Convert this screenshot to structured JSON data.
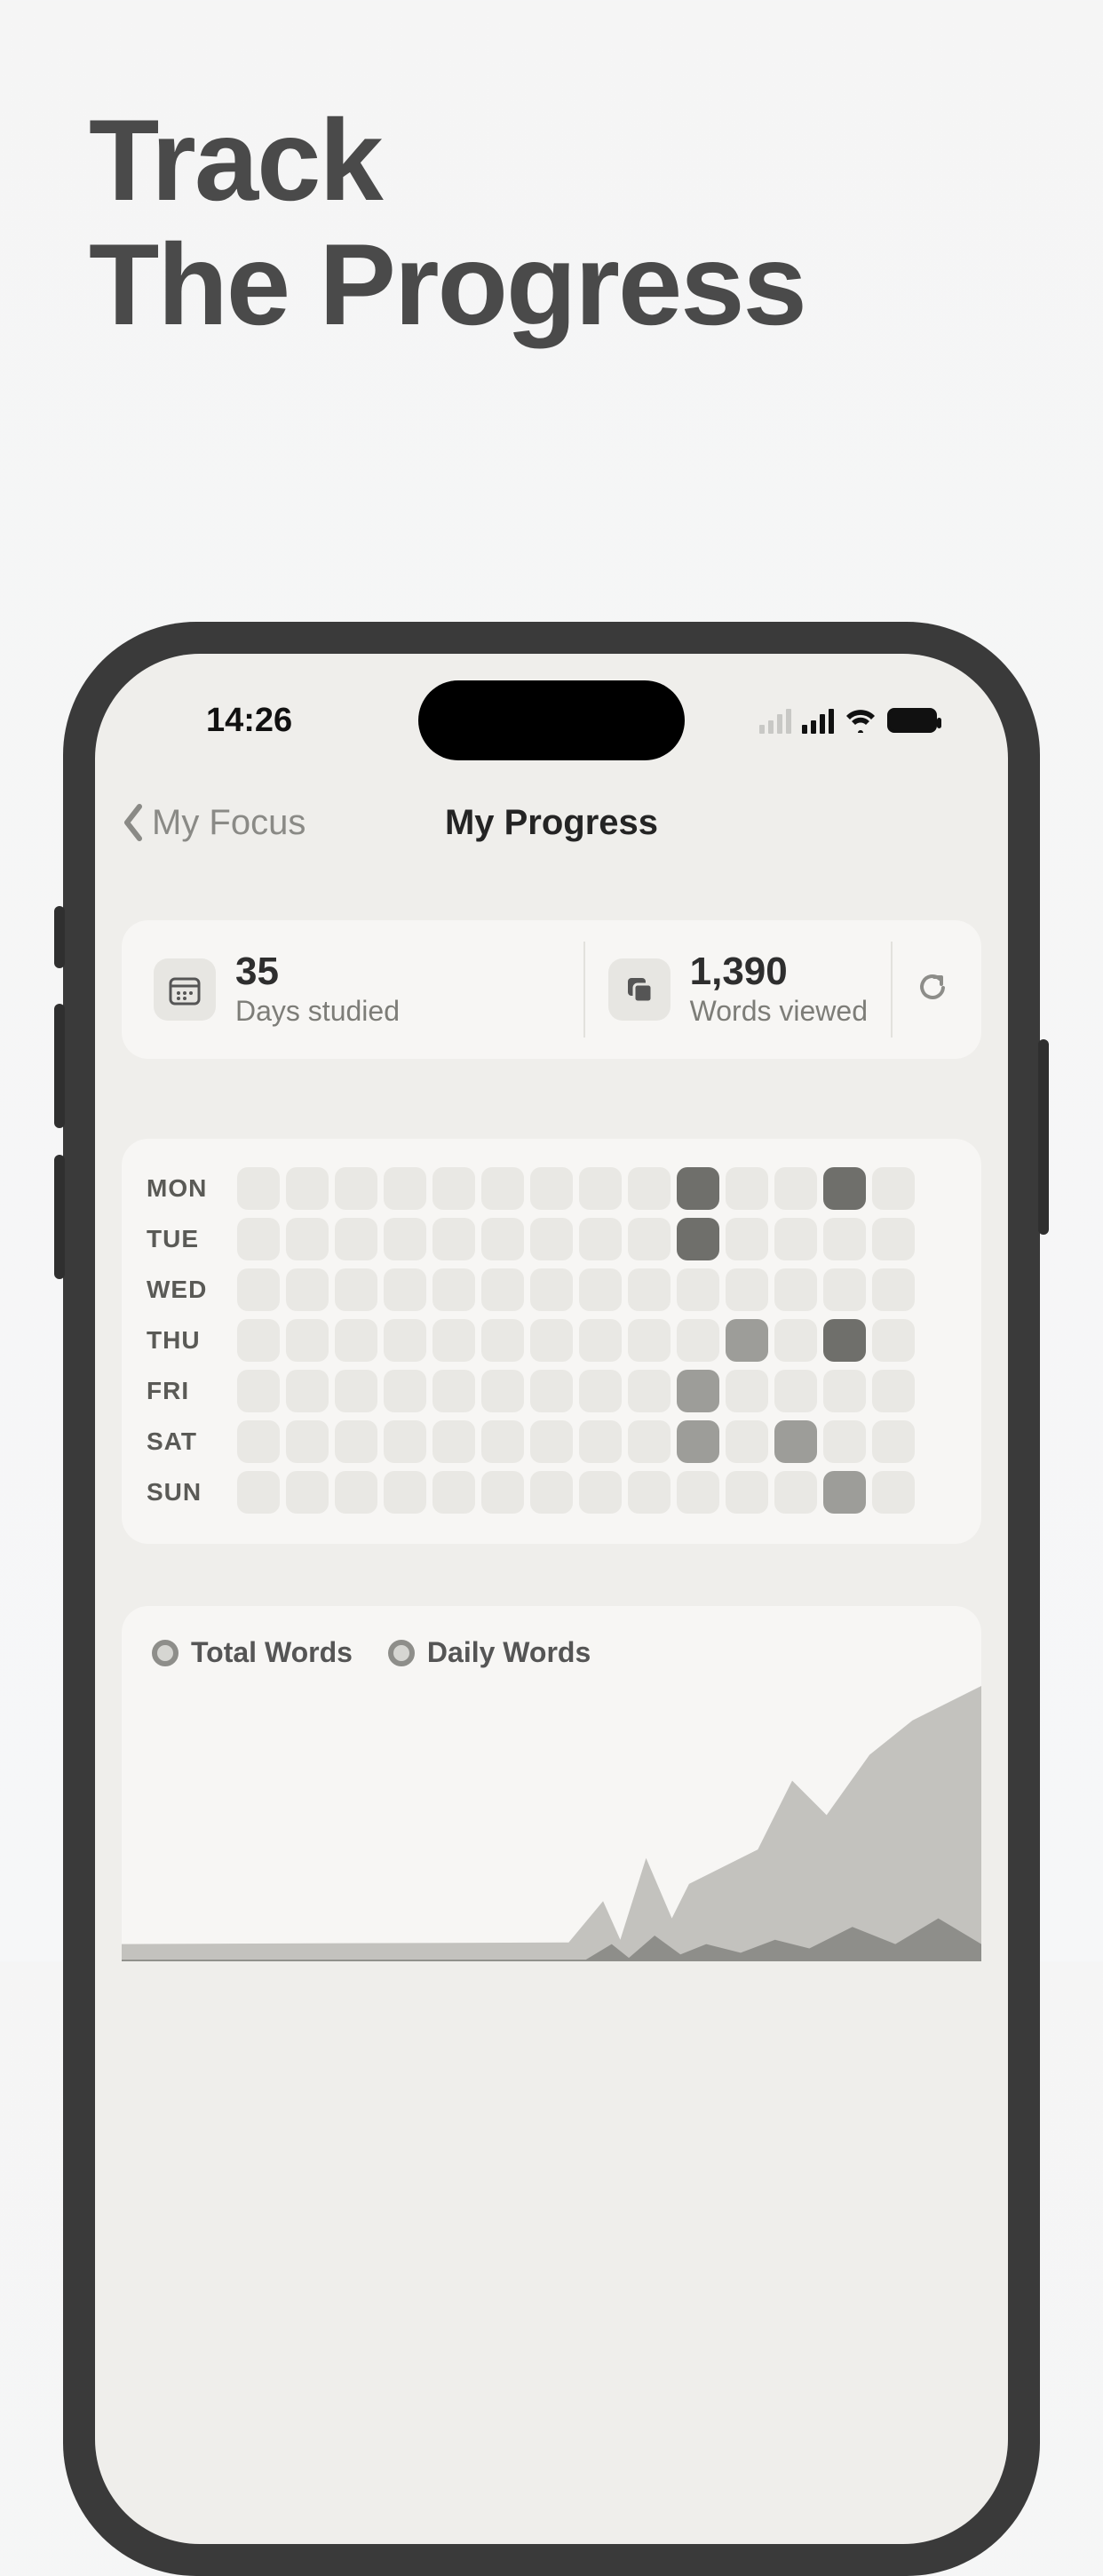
{
  "marketing": {
    "headline_line1": "Track",
    "headline_line2": "The Progress"
  },
  "status": {
    "time": "14:26"
  },
  "nav": {
    "back_label": "My Focus",
    "title": "My Progress"
  },
  "stats": {
    "days_value": "35",
    "days_label": "Days studied",
    "words_value": "1,390",
    "words_label": "Words viewed"
  },
  "heatmap": {
    "days": [
      "MON",
      "TUE",
      "WED",
      "THU",
      "FRI",
      "SAT",
      "SUN"
    ],
    "grid": [
      [
        0,
        0,
        0,
        0,
        0,
        0,
        0,
        0,
        0,
        3,
        0,
        0,
        3,
        0
      ],
      [
        0,
        0,
        0,
        0,
        0,
        0,
        0,
        0,
        0,
        3,
        0,
        0,
        0,
        0
      ],
      [
        0,
        0,
        0,
        0,
        0,
        0,
        0,
        0,
        0,
        0,
        0,
        0,
        0,
        0
      ],
      [
        0,
        0,
        0,
        0,
        0,
        0,
        0,
        0,
        0,
        0,
        2,
        0,
        3,
        0
      ],
      [
        0,
        0,
        0,
        0,
        0,
        0,
        0,
        0,
        0,
        2,
        0,
        0,
        0,
        0
      ],
      [
        0,
        0,
        0,
        0,
        0,
        0,
        0,
        0,
        0,
        2,
        0,
        2,
        0,
        0
      ],
      [
        0,
        0,
        0,
        0,
        0,
        0,
        0,
        0,
        0,
        0,
        0,
        0,
        2,
        0
      ]
    ]
  },
  "chart": {
    "legend_total": "Total Words",
    "legend_daily": "Daily Words"
  }
}
